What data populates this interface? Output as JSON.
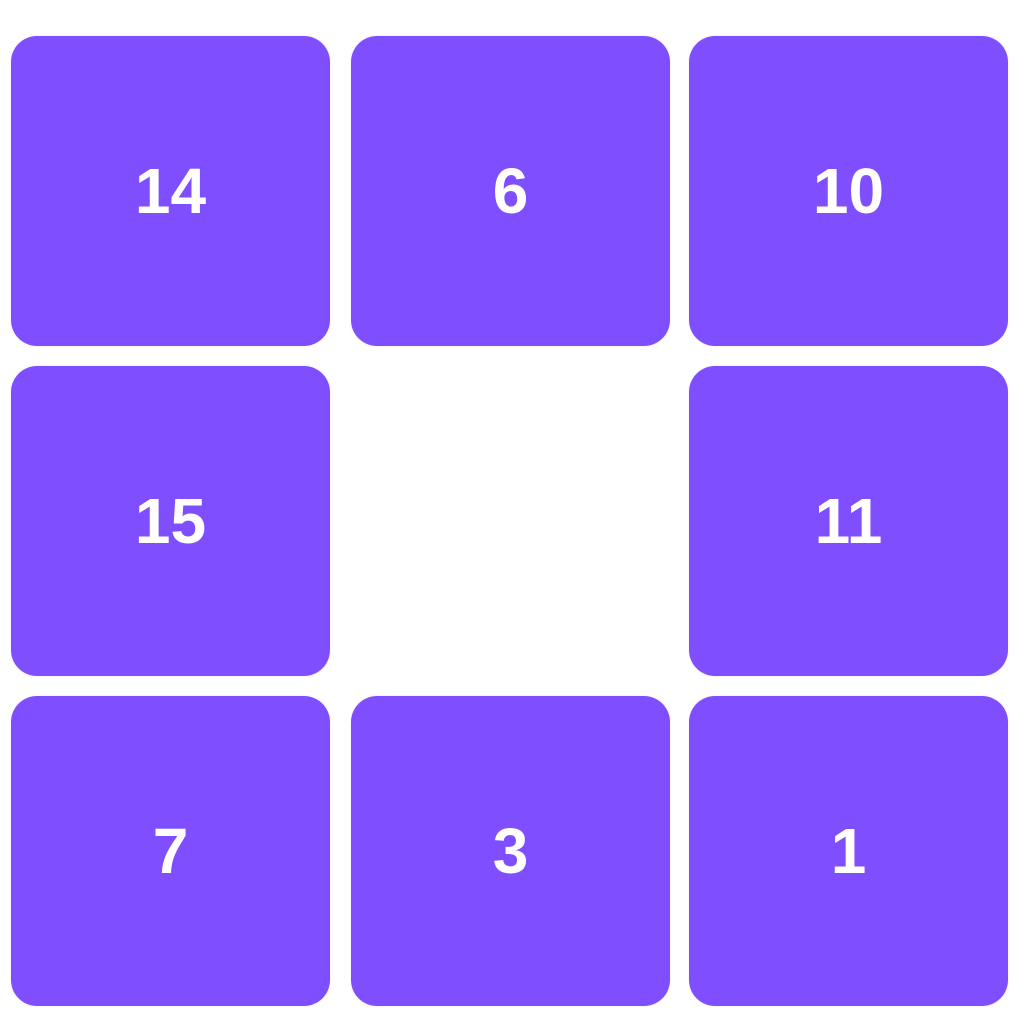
{
  "puzzle": {
    "tile_color": "#7f4fff",
    "text_color": "#ffffff",
    "tiles": [
      "14",
      "6",
      "10",
      "15",
      "",
      "11",
      "7",
      "3",
      "1"
    ]
  }
}
